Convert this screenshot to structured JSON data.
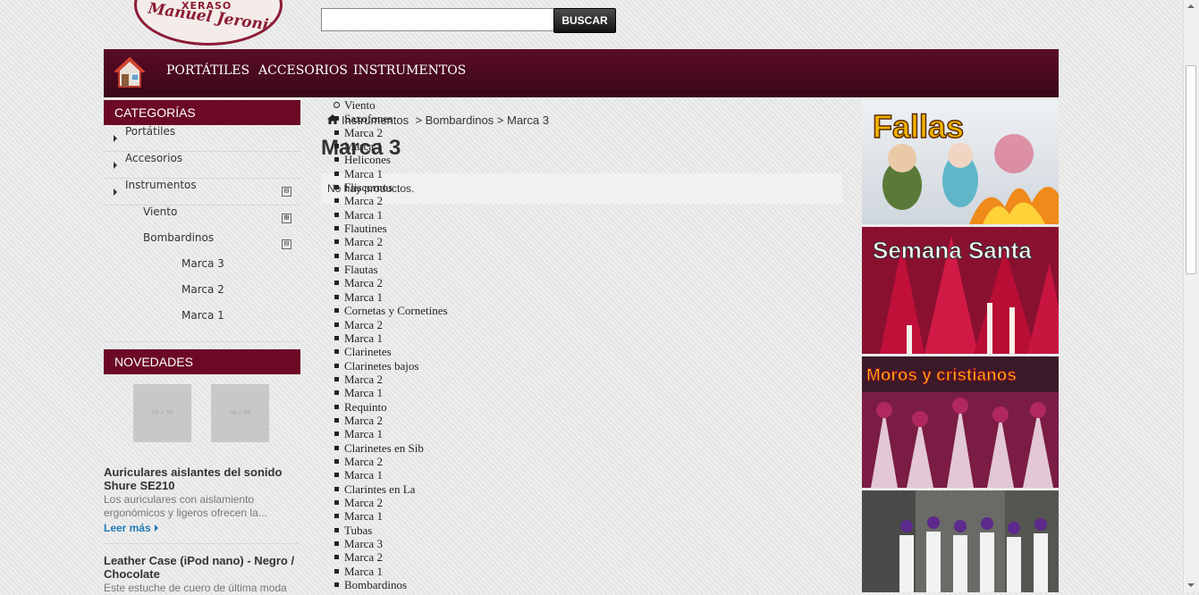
{
  "logo": {
    "top_text": "XERASO",
    "script_text": "Manuel Jeronimo"
  },
  "search": {
    "value": "",
    "placeholder": "",
    "button_label": "BUSCAR"
  },
  "nav": {
    "items": [
      "PORTÁTILES",
      "ACCESORIOS",
      "INSTRUMENTOS"
    ]
  },
  "categories": {
    "title": "CATEGORÍAS",
    "items": [
      "Portátiles",
      "Accesorios",
      "Instrumentos",
      "Viento",
      "Bombardinos",
      "Marca 3",
      "Marca 2",
      "Marca 1"
    ],
    "toggles": [
      "⊟",
      "⊞",
      "⊟"
    ]
  },
  "novedades": {
    "title": "NOVEDADES",
    "thumb_label": "58 x 58",
    "products": [
      {
        "title": "Auriculares aislantes del sonido Shure SE210",
        "desc": "Los auriculares con aislamiento ergonómicos y ligeros ofrecen la...",
        "more": "Leer más"
      },
      {
        "title": "Leather Case (iPod nano) - Negro / Chocolate",
        "desc": "Este estuche de cuero de última moda"
      }
    ]
  },
  "breadcrumb": "Instrumentos  > Bombardinos > Marca 3",
  "page_title": "Marca 3",
  "notice": "No hay productos.",
  "tree": [
    "Viento",
    "Saxofones",
    "Marca 2",
    "Marca 1",
    "Helicones",
    "Marca 1",
    "Fliscornos",
    "Marca 2",
    "Marca 1",
    "Flautines",
    "Marca 2",
    "Marca 1",
    "Flautas",
    "Marca 2",
    "Marca 1",
    "Cornetas y Cornetines",
    "Marca 2",
    "Marca 1",
    "Clarinetes",
    "Clarinetes bajos",
    "Marca 2",
    "Marca 1",
    "Requinto",
    "Marca 2",
    "Marca 1",
    "Clarinetes en Sib",
    "Marca 2",
    "Marca 1",
    "Clarintes en La",
    "Marca 2",
    "Marca 1",
    "Tubas",
    "Marca 3",
    "Marca 2",
    "Marca 1",
    "Bombardinos"
  ],
  "banners": [
    "Fallas",
    "Semana Santa",
    "Moros y cristianos",
    ""
  ],
  "colors": {
    "nav_bg": "#4a0a20",
    "box_title_bg": "#6c0a26",
    "link": "#1f7ab8"
  }
}
